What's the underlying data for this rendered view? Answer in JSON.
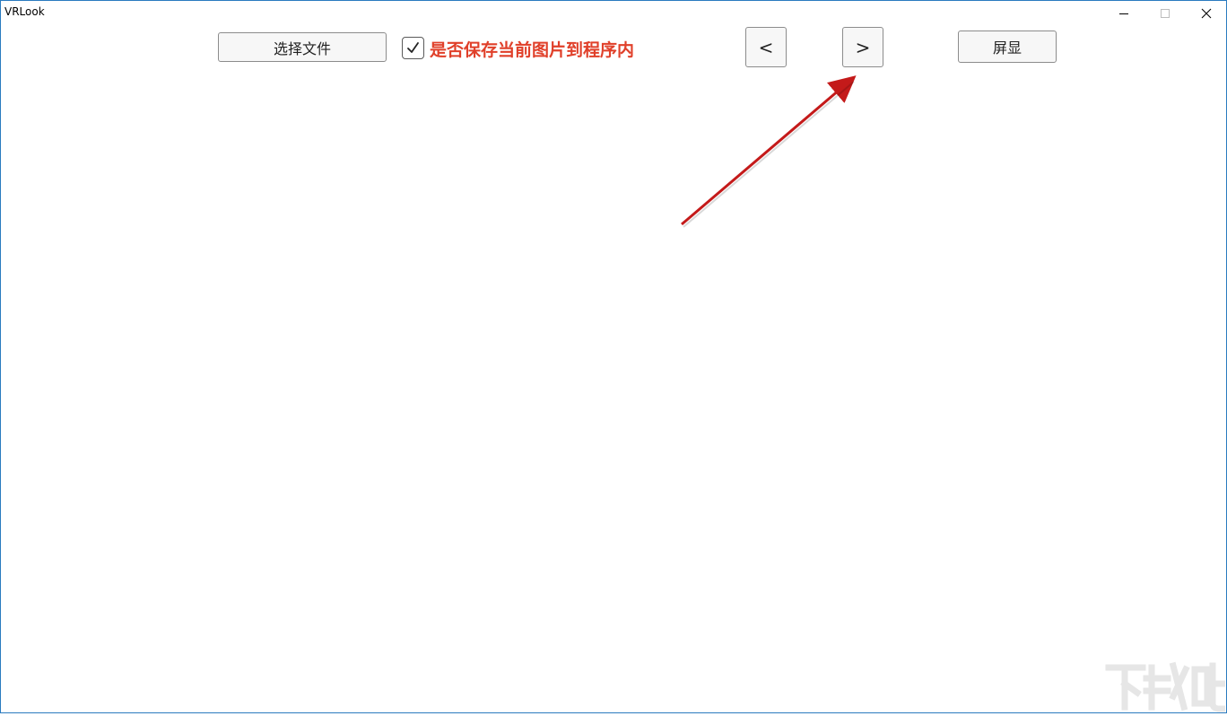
{
  "window": {
    "title": "VRLook"
  },
  "toolbar": {
    "select_file_label": "选择文件",
    "save_checkbox_checked": true,
    "save_checkbox_label": "是否保存当前图片到程序内",
    "prev_label": "<",
    "next_label": ">",
    "fullscreen_label": "屏显"
  },
  "colors": {
    "label_red": "#e0402a",
    "arrow_red": "#c41a1a",
    "window_border": "#2b7bbf"
  },
  "watermark": {
    "text": "下载吧"
  }
}
